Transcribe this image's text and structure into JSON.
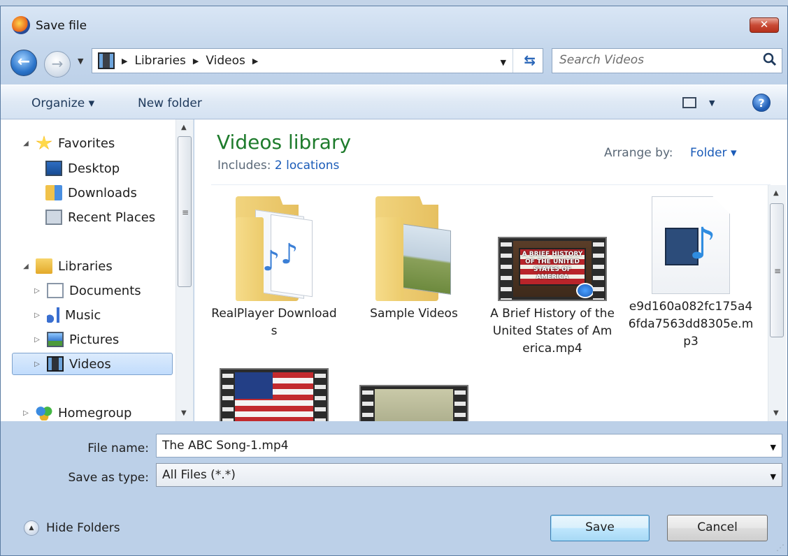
{
  "window": {
    "title": "Save file",
    "close_label": "✕"
  },
  "address": {
    "crumbs": [
      "Libraries",
      "Videos"
    ],
    "search_placeholder": "Search Videos"
  },
  "toolbar": {
    "organize": "Organize ▾",
    "new_folder": "New folder"
  },
  "nav": {
    "favorites": "Favorites",
    "desktop": "Desktop",
    "downloads": "Downloads",
    "recent": "Recent Places",
    "libraries": "Libraries",
    "documents": "Documents",
    "music": "Music",
    "pictures": "Pictures",
    "videos": "Videos",
    "homegroup": "Homegroup"
  },
  "content": {
    "title": "Videos library",
    "includes_label": "Includes:",
    "includes_link": "2 locations",
    "arrange_label": "Arrange by:",
    "arrange_value": "Folder ▾",
    "items": [
      {
        "label": "RealPlayer Downloads"
      },
      {
        "label": "Sample Videos"
      },
      {
        "label": "A Brief History of the United States of America.mp4"
      },
      {
        "label": "e9d160a082fc175a46fda7563dd8305e.mp3"
      }
    ],
    "thumb_caption": "A BRIEF HISTORY OF THE UNITED STATES OF AMERICA"
  },
  "form": {
    "file_name_label": "File name:",
    "file_name_value": "The ABC Song-1.mp4",
    "save_type_label": "Save as type:",
    "save_type_value": "All Files (*.*)"
  },
  "footer": {
    "hide_folders": "Hide Folders",
    "save": "Save",
    "cancel": "Cancel"
  }
}
